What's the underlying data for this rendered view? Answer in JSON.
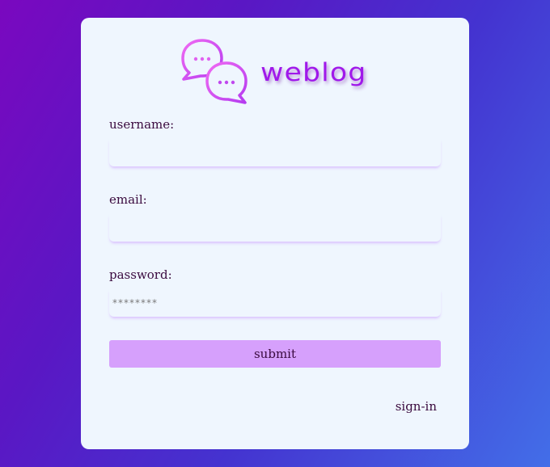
{
  "brand": {
    "logo_icon": "chat-bubbles-icon",
    "name": "weblog",
    "accent_color": "#a019ea"
  },
  "form": {
    "fields": [
      {
        "label": "username:",
        "value": "",
        "placeholder": ""
      },
      {
        "label": "email:",
        "value": "",
        "placeholder": ""
      },
      {
        "label": "password:",
        "value": "",
        "placeholder": "********"
      }
    ],
    "submit_label": "submit",
    "submit_color": "#d6a0fc"
  },
  "footer": {
    "signin_label": "sign-in"
  }
}
